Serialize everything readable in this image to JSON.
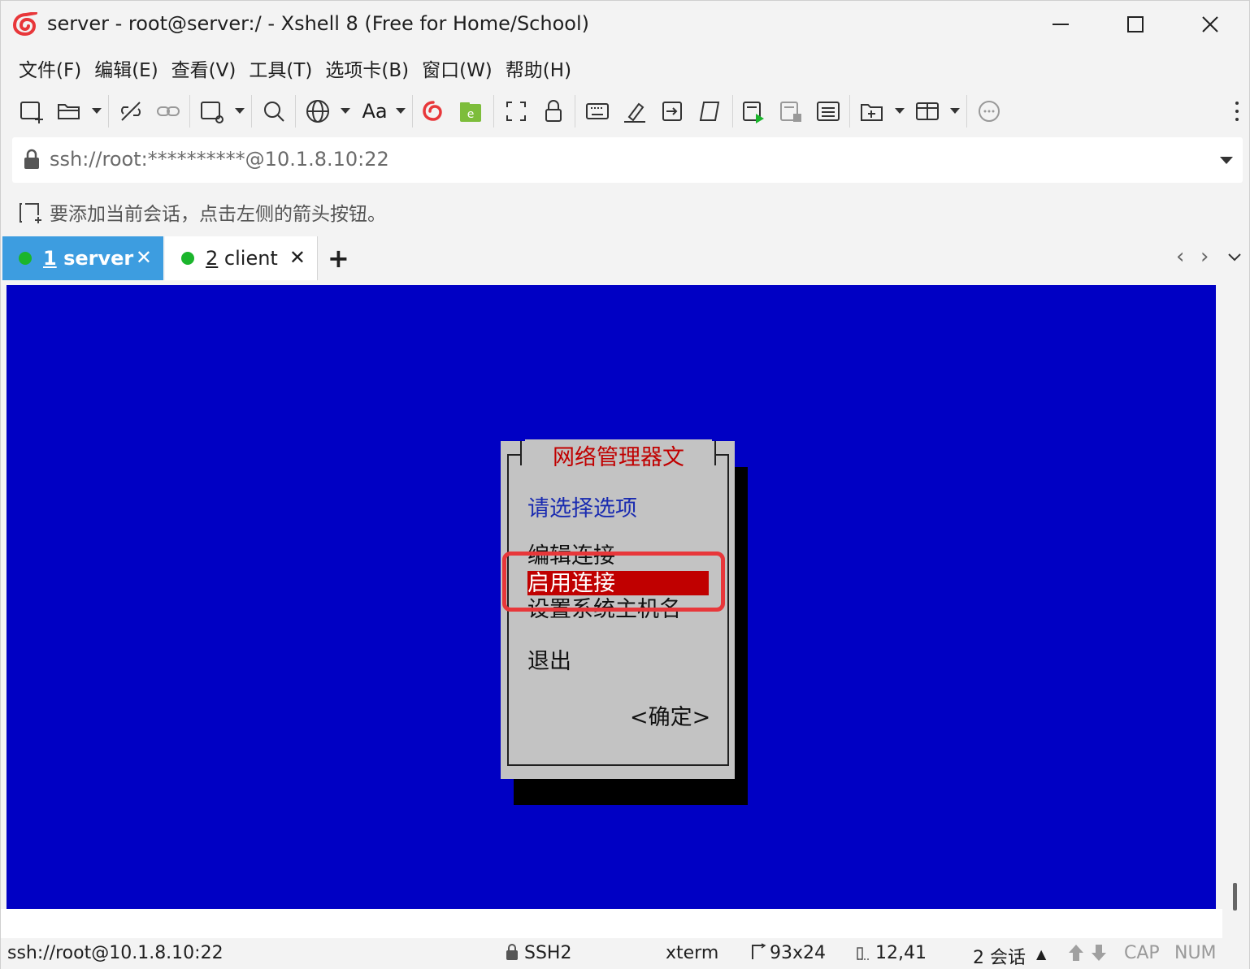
{
  "window": {
    "title": "server - root@server:/ - Xshell 8 (Free for Home/School)"
  },
  "menu": {
    "items": [
      "文件(F)",
      "编辑(E)",
      "查看(V)",
      "工具(T)",
      "选项卡(B)",
      "窗口(W)",
      "帮助(H)"
    ]
  },
  "toolbar": {
    "icons": [
      "new-session-icon",
      "open-folder-icon",
      "disconnect-icon",
      "reconnect-icon",
      "session-properties-icon",
      "search-icon",
      "globe-icon",
      "font-icon",
      "xshell-icon",
      "xftp-icon",
      "fullscreen-icon",
      "lock-icon",
      "keyboard-icon",
      "highlight-icon",
      "transfer-icon",
      "script-icon",
      "start-log-icon",
      "stop-log-icon",
      "compose-icon",
      "new-tab-group-icon",
      "layout-icon",
      "chat-icon"
    ],
    "font_label": "Aa"
  },
  "address": {
    "value": "ssh://root:**********@10.1.8.10:22"
  },
  "hint": {
    "text": "要添加当前会话，点击左侧的箭头按钮。"
  },
  "tabs": [
    {
      "number": "1",
      "name": "server",
      "active": true
    },
    {
      "number": "2",
      "name": "client",
      "active": false
    }
  ],
  "tab_add_label": "+",
  "dialog": {
    "title": "网络管理器文",
    "prompt": "请选择选项",
    "options": [
      "编辑连接",
      "启用连接",
      "设置系统主机名"
    ],
    "quit": "退出",
    "ok": "<确定>",
    "selected_option": "启用连接"
  },
  "status": {
    "connection": "ssh://root@10.1.8.10:22",
    "protocol": "SSH2",
    "terminal": "xterm",
    "size": "93x24",
    "cursor": "12,41",
    "sessions": "2 会话",
    "cap": "CAP",
    "num": "NUM"
  },
  "colors": {
    "terminal_bg": "#0000c4",
    "active_tab": "#3d9de0",
    "dialog_bg": "#c3c3c3",
    "selection": "#c00000",
    "highlight_box": "#e8373a",
    "status_dot": "#1bb52c"
  }
}
